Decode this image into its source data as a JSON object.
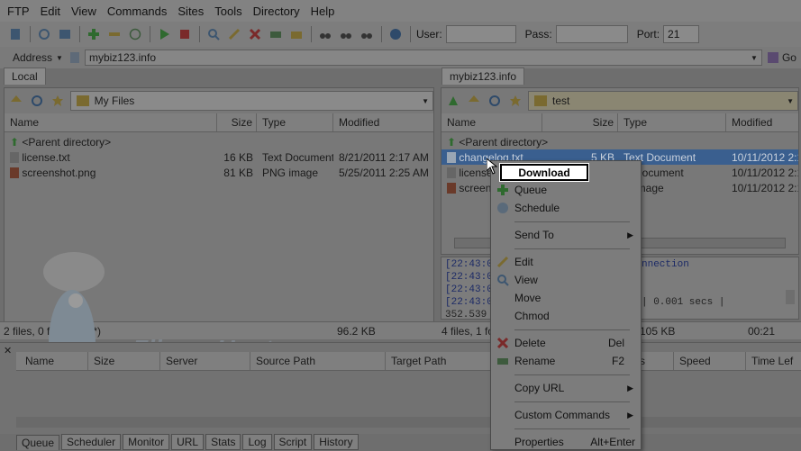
{
  "menu": [
    "FTP",
    "Edit",
    "View",
    "Commands",
    "Sites",
    "Tools",
    "Directory",
    "Help"
  ],
  "connection": {
    "user_label": "User:",
    "user_value": "",
    "pass_label": "Pass:",
    "pass_value": "",
    "port_label": "Port:",
    "port_value": "21"
  },
  "address": {
    "label": "Address",
    "value": "mybiz123.info",
    "go_label": "Go"
  },
  "local": {
    "tab": "Local",
    "path": "My Files",
    "columns": [
      "Name",
      "Size",
      "Type",
      "Modified"
    ],
    "rows": [
      {
        "name": "<Parent directory>",
        "size": "",
        "type": "",
        "modified": ""
      },
      {
        "name": "license.txt",
        "size": "16 KB",
        "type": "Text Document",
        "modified": "8/21/2011 2:17 AM"
      },
      {
        "name": "screenshot.png",
        "size": "81 KB",
        "type": "PNG image",
        "modified": "5/25/2011 2:25 AM"
      }
    ],
    "status_left": "2 files, 0 folders (*.*)",
    "status_right": "96.2 KB"
  },
  "remote": {
    "tab": "mybiz123.info",
    "path": "test",
    "columns": [
      "Name",
      "Size",
      "Type",
      "Modified"
    ],
    "rows": [
      {
        "name": "<Parent directory>",
        "size": "",
        "type": "",
        "modified": ""
      },
      {
        "name": "changelog.txt",
        "size": "5 KB",
        "type": "Text Document",
        "modified": "10/11/2012 2:1"
      },
      {
        "name": "license",
        "size": "",
        "type": "Document",
        "modified": "10/11/2012 2:1"
      },
      {
        "name": "screen",
        "size": "",
        "type": "image",
        "modified": "10/11/2012 2:1"
      }
    ],
    "log": [
      "[22:43:0",
      "[22:43:0",
      "[22:43:0",
      "[22:43:0",
      "352.539"
    ],
    "log_right": [
      "nnection",
      "",
      "",
      "| 0.001 secs |",
      ""
    ],
    "status_left": "4 files, 1 fo",
    "status_mid": "105 KB",
    "status_right": "00:21"
  },
  "watermark": "FlipperHost",
  "queue": {
    "columns": [
      "Name",
      "Size",
      "Server",
      "Source Path",
      "Target Path",
      "ss",
      "Speed",
      "Time Lef"
    ],
    "tabs": [
      "Queue",
      "Scheduler",
      "Monitor",
      "URL",
      "Stats",
      "Log",
      "Script",
      "History"
    ]
  },
  "context_menu": {
    "highlighted": "Download",
    "items": [
      {
        "label": "Queue",
        "shortcut": "",
        "icon": "plus-icon"
      },
      {
        "label": "Schedule",
        "shortcut": "",
        "icon": "clock-icon"
      },
      {
        "label": "Send To",
        "shortcut": "",
        "icon": "",
        "submenu": true
      },
      {
        "label": "Edit",
        "shortcut": "",
        "icon": "pencil-icon"
      },
      {
        "label": "View",
        "shortcut": "",
        "icon": "magnifier-icon"
      },
      {
        "label": "Move",
        "shortcut": "",
        "icon": ""
      },
      {
        "label": "Chmod",
        "shortcut": "",
        "icon": ""
      },
      {
        "label": "Delete",
        "shortcut": "Del",
        "icon": "delete-x-icon"
      },
      {
        "label": "Rename",
        "shortcut": "F2",
        "icon": "rename-icon"
      },
      {
        "label": "Copy URL",
        "shortcut": "",
        "icon": "",
        "submenu": true
      },
      {
        "label": "Custom Commands",
        "shortcut": "",
        "icon": "",
        "submenu": true
      },
      {
        "label": "Properties",
        "shortcut": "Alt+Enter",
        "icon": ""
      }
    ]
  },
  "colors": {
    "dim_overlay": "#6e6e6e",
    "highlight_bg": "#ffffff",
    "selection": "#3a5f8f"
  }
}
